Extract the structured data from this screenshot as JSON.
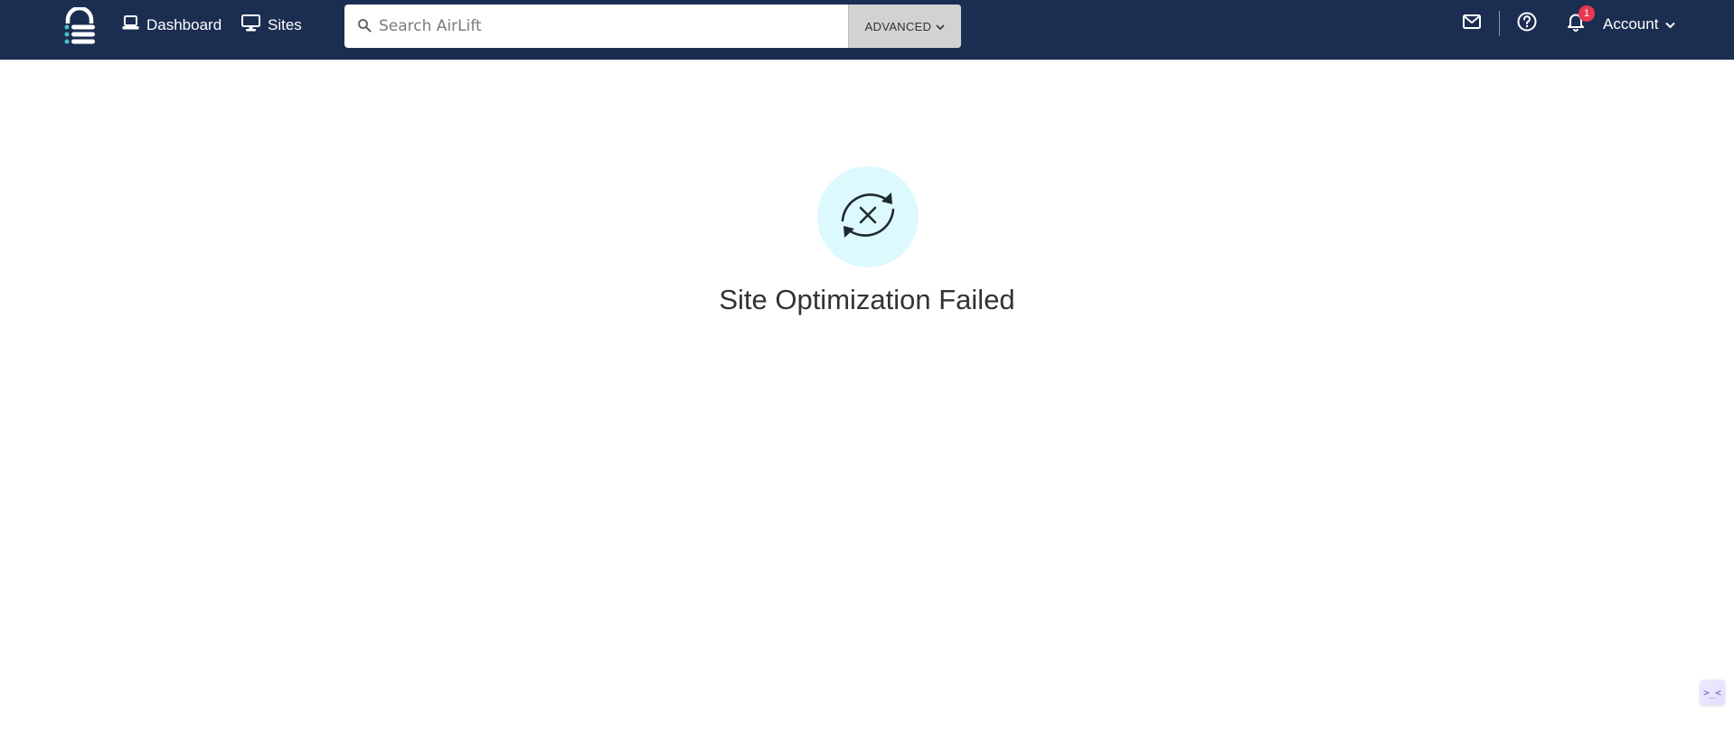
{
  "header": {
    "nav": [
      {
        "label": "Dashboard",
        "icon": "laptop-icon"
      },
      {
        "label": "Sites",
        "icon": "monitor-icon"
      }
    ],
    "search": {
      "placeholder": "Search AirLift",
      "value": "",
      "advanced_label": "ADVANCED"
    },
    "notifications_count": "1",
    "account_label": "Account"
  },
  "main": {
    "status_title": "Site Optimization Failed",
    "status_icon": "sync-failed-icon"
  },
  "widget": {
    "glyph": ">_<"
  },
  "colors": {
    "header_bg": "#1b2e52",
    "accent_teal": "#49c2c8",
    "icon_circle_bg": "#dcfafe",
    "badge_red": "#e8384f",
    "advanced_bg": "#d2d2d2"
  }
}
